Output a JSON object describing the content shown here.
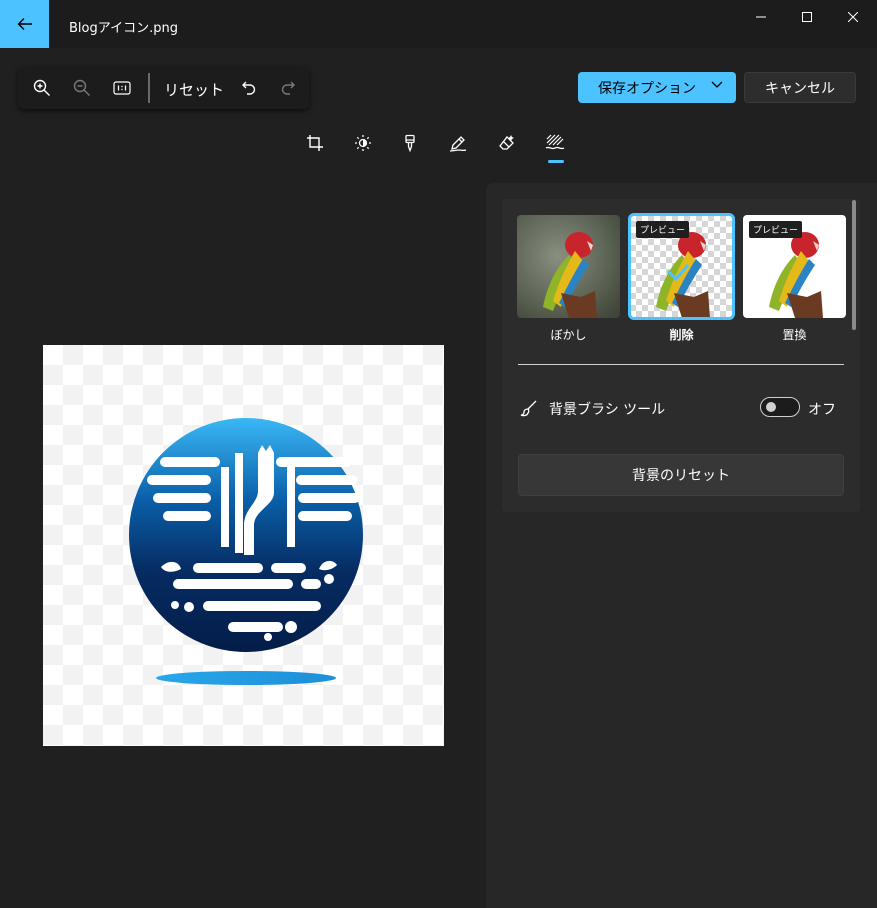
{
  "window": {
    "title": "Blogアイコン.png"
  },
  "toolbar": {
    "reset_label": "リセット"
  },
  "actions": {
    "save_label": "保存オプション",
    "cancel_label": "キャンセル"
  },
  "edit_tabs": [
    "crop-icon",
    "adjust-icon",
    "filter-icon",
    "markup-icon",
    "erase-icon",
    "background-icon"
  ],
  "background_panel": {
    "options": [
      {
        "label": "ぼかし",
        "tag": "",
        "selected": false
      },
      {
        "label": "削除",
        "tag": "プレビュー",
        "selected": true
      },
      {
        "label": "置換",
        "tag": "プレビュー",
        "selected": false
      }
    ],
    "brush_tool_label": "背景ブラシ ツール",
    "brush_tool_state": "オフ",
    "reset_background_label": "背景のリセット"
  },
  "colors": {
    "accent": "#4cc2ff",
    "background": "#202020",
    "panel": "#272727"
  }
}
